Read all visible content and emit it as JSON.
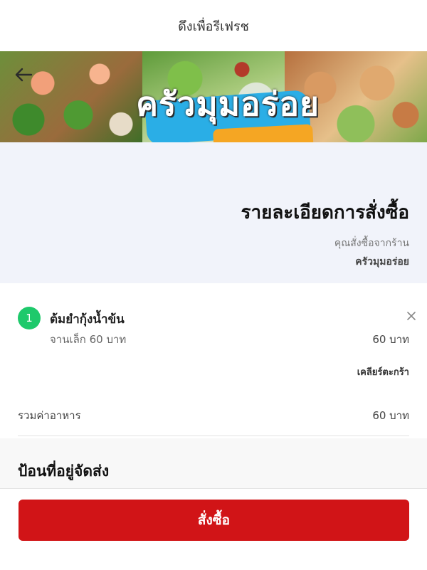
{
  "pull_refresh": {
    "label": "ดึงเพื่อรีเฟรช"
  },
  "banner": {
    "brand_text": "ครัวมุมอร่อย",
    "back_icon": "arrow-left-icon",
    "colors": {
      "brush_blue": "#2aaee6",
      "brush_orange": "#f5a623"
    }
  },
  "order_summary": {
    "title": "รายละเอียดการสั่งซื้อ",
    "from_label": "คุณสั่งซื้อจากร้าน",
    "shop_name": "ครัวมุมอร่อย"
  },
  "cart": {
    "items": [
      {
        "quantity": "1",
        "name": "ต้มยำกุ้งน้ำข้น",
        "option": "จานเล็ก  60 บาท",
        "price": "60 บาท",
        "remove_icon": "close-icon"
      }
    ],
    "clear_label": "เคลียร์ตะกร้า",
    "total_label": "รวมค่าอาหาร",
    "total_value": "60 บาท"
  },
  "address": {
    "heading": "ป้อนที่อยู่จัดส่ง"
  },
  "footer": {
    "order_button_label": "สั่งซื้อ",
    "button_color": "#d11417",
    "badge_color": "#1ec96b"
  }
}
